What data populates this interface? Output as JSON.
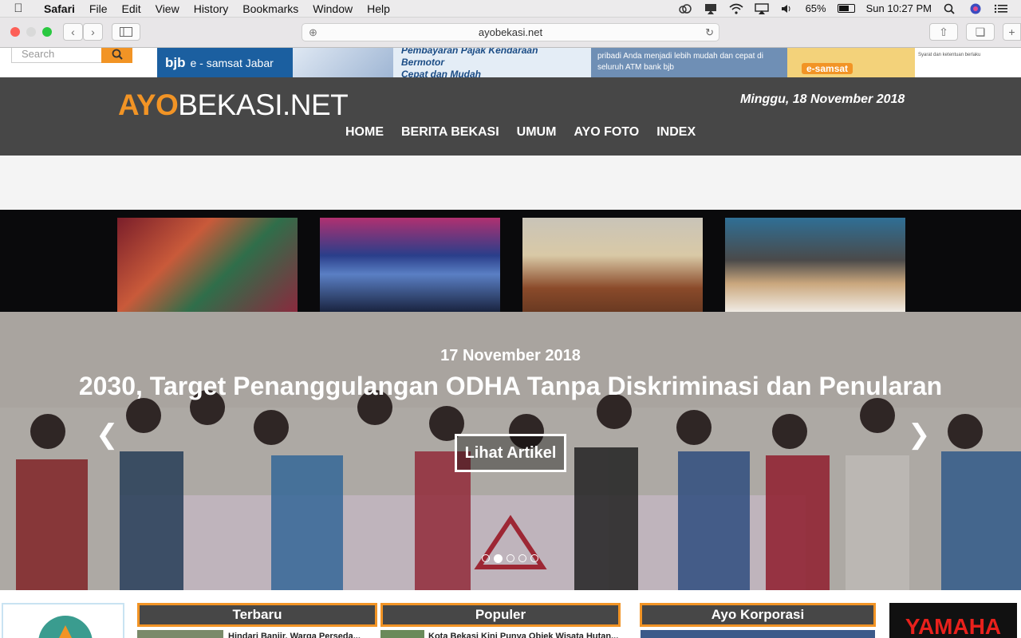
{
  "menubar": {
    "app": "Safari",
    "menus": [
      "File",
      "Edit",
      "View",
      "History",
      "Bookmarks",
      "Window",
      "Help"
    ],
    "battery": "65%",
    "clock": "Sun 10:27 PM"
  },
  "browser": {
    "url": "ayobekasi.net"
  },
  "site": {
    "search_placeholder": "Search",
    "logo_ayo": "AYO",
    "logo_rest": "BEKASI.NET",
    "date": "Minggu, 18 November 2018",
    "nav": [
      "HOME",
      "BERITA BEKASI",
      "UMUM",
      "AYO FOTO",
      "INDEX"
    ]
  },
  "banner": {
    "brand": "bjb",
    "title": "e - samsat Jabar",
    "tagline_1": "Pembayaran Pajak Kendaraan Bermotor",
    "tagline_2": "Cepat dan Mudah",
    "desc_1": "pribadi Anda menjadi lebih mudah dan cepat di",
    "desc_2": "seluruh ATM bank bjb",
    "esamsat": "e-samsat",
    "small": "Syarat dan ketentuan berlaku"
  },
  "hero": {
    "date": "17 November 2018",
    "title": "2030, Target Penanggulangan ODHA Tanpa Diskriminasi dan Penularan",
    "button": "Lihat Artikel",
    "slide_count": 5,
    "active_slide": 2
  },
  "bottom": {
    "terbaru": "Terbaru",
    "populer": "Populer",
    "korporasi": "Ayo Korporasi",
    "terbaru_item": "Hindari Banjir, Warga Perseda...",
    "populer_item": "Kota Bekasi Kini Punya Objek Wisata Hutan...",
    "yamaha": "YAMAHA"
  },
  "colors": {
    "accent": "#f29425",
    "header_bg": "#474747",
    "thumbs_bg": "#0a0a0c"
  }
}
